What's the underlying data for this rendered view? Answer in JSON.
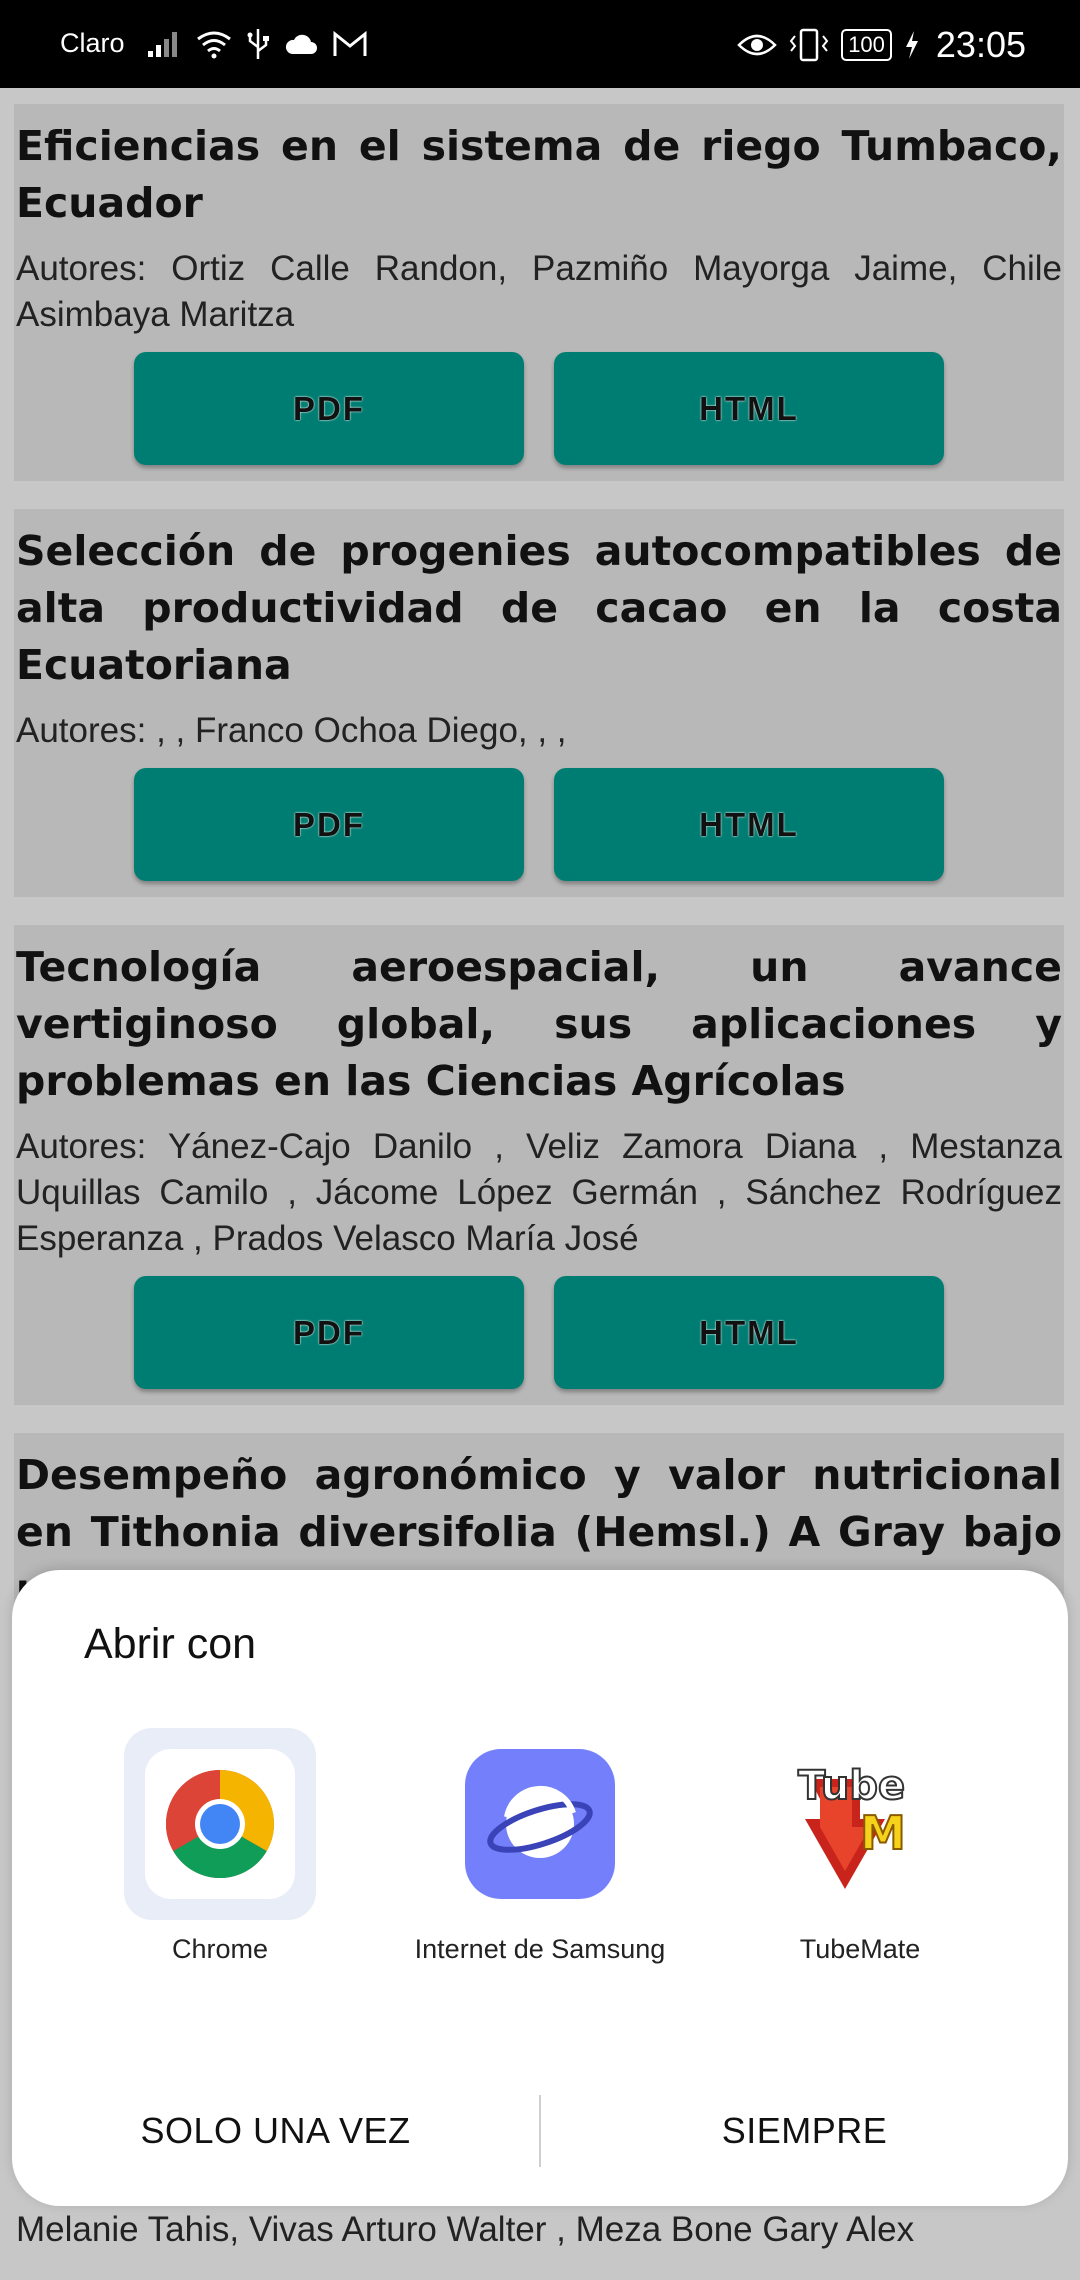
{
  "status_bar": {
    "carrier": "Claro",
    "battery": "100",
    "time": "23:05"
  },
  "articles": [
    {
      "title": "Eficiencias en el sistema de riego Tumbaco, Ecuador",
      "authors": "Autores: Ortiz Calle Randon, Pazmiño Mayorga Jaime, Chile Asimbaya Maritza",
      "pdf_label": "PDF",
      "html_label": "HTML"
    },
    {
      "title": "Selección de progenies autocompatibles de alta productividad de cacao en la costa Ecuatoriana",
      "authors": "Autores:  , ,  Franco Ochoa Diego,  , ,",
      "pdf_label": "PDF",
      "html_label": "HTML"
    },
    {
      "title": "Tecnología aeroespacial, un avance vertiginoso global, sus aplicaciones y problemas en las Ciencias Agrícolas",
      "authors": "Autores: Yánez-Cajo Danilo , Veliz Zamora Diana , Mestanza Uquillas Camilo , Jácome López Germán , Sánchez Rodríguez Esperanza , Prados Velasco María José",
      "pdf_label": "PDF",
      "html_label": "HTML"
    },
    {
      "title": "Desempeño agronómico y valor nutricional en Tithonia diversifolia (Hemsl.) A Gray bajo un sistema de corte"
    }
  ],
  "peek_authors": "Melanie Tahis, Vivas Arturo Walter , Meza Bone Gary Alex",
  "sheet": {
    "title": "Abrir con",
    "apps": [
      {
        "label": "Chrome",
        "icon": "chrome-icon",
        "selected": true
      },
      {
        "label": "Internet de Samsung",
        "icon": "samsung-internet-icon",
        "selected": false
      },
      {
        "label": "TubeMate",
        "icon": "tubemate-icon",
        "selected": false
      }
    ],
    "just_once": "SOLO UNA VEZ",
    "always": "SIEMPRE"
  },
  "colors": {
    "button": "#007d72",
    "card": "#b8b8b8",
    "background": "#c7c7c7",
    "samsung": "#7480fb"
  }
}
